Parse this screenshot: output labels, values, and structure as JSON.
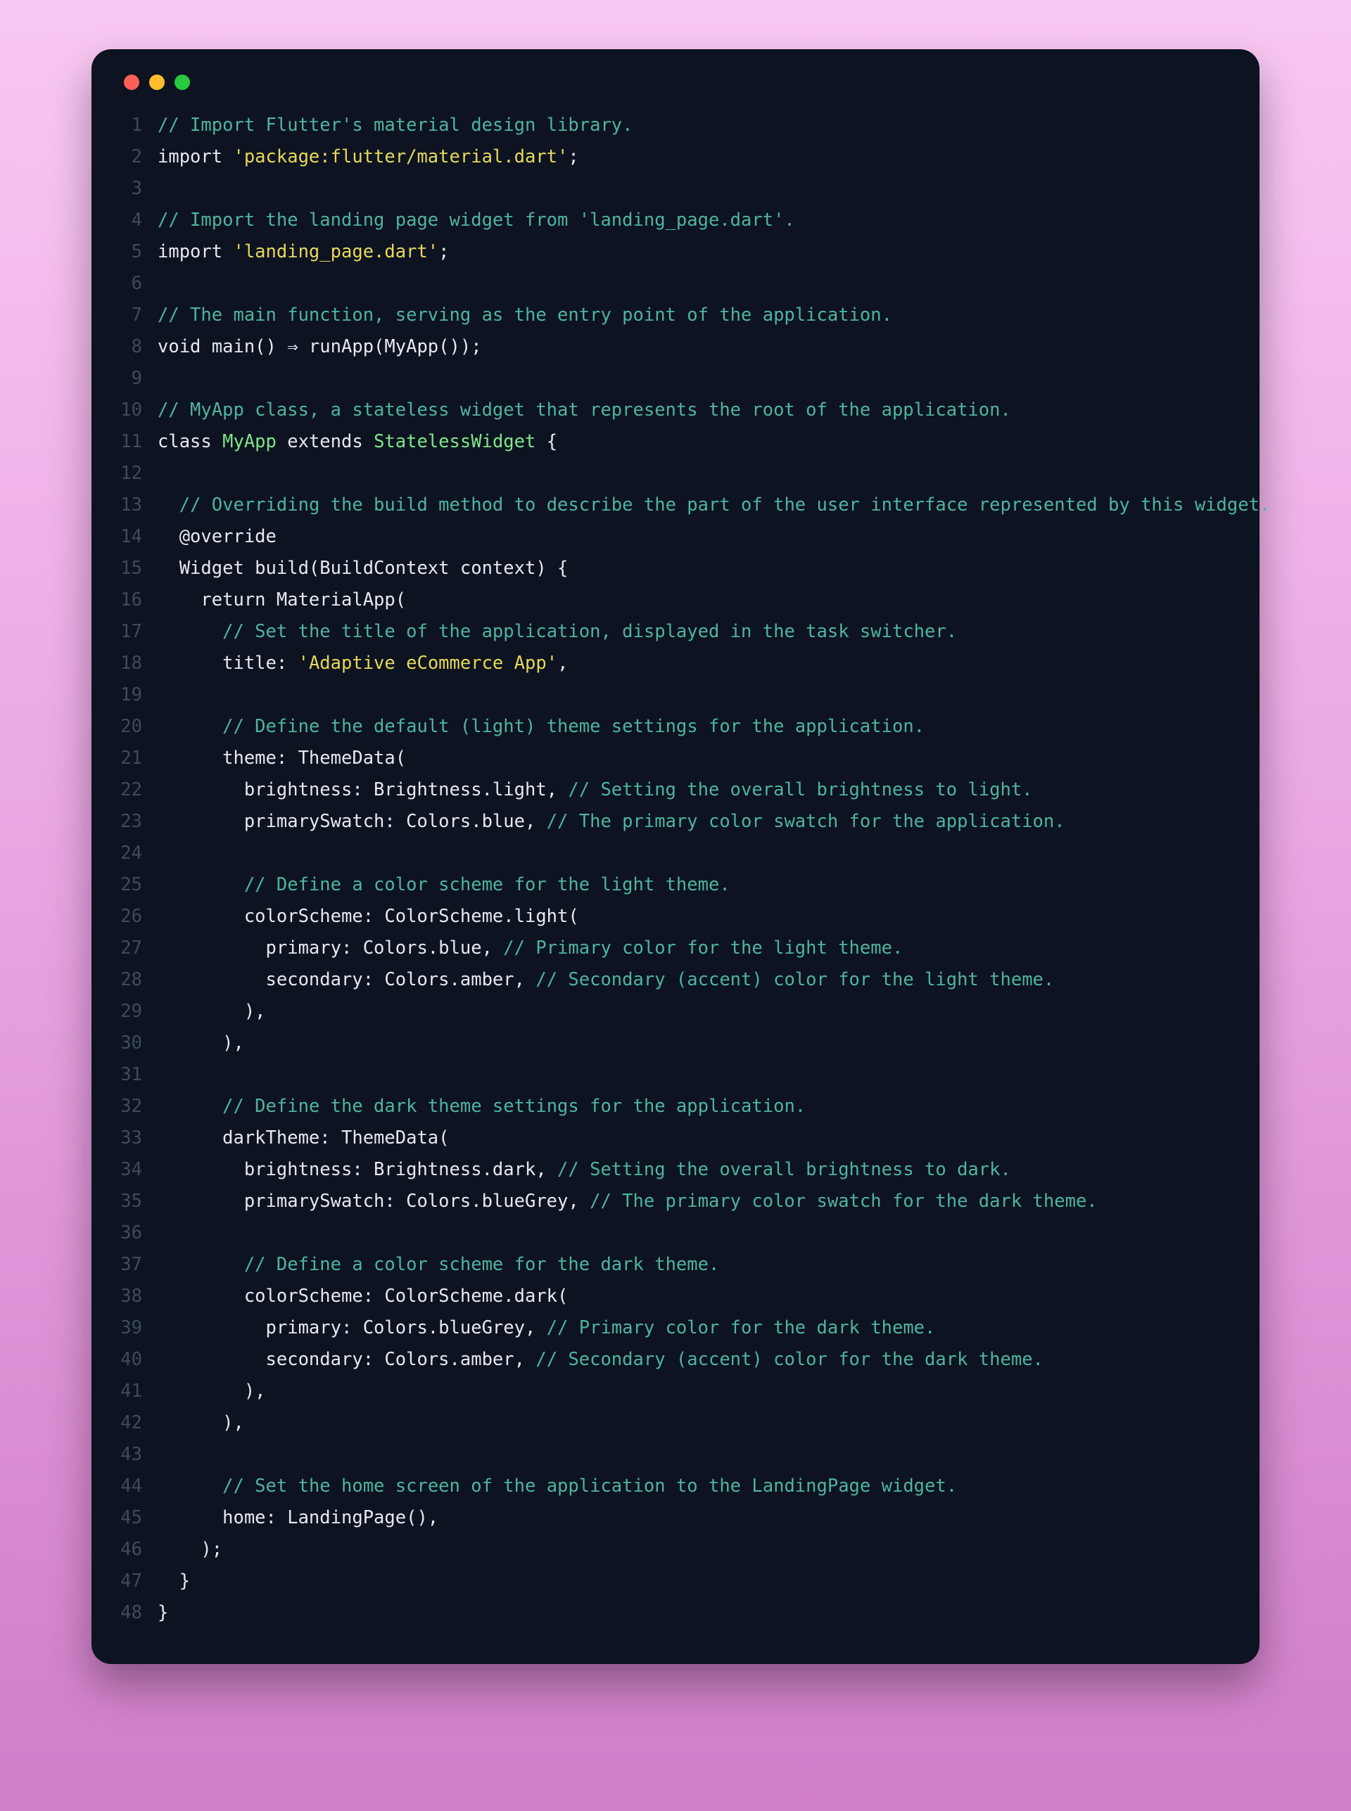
{
  "window": {
    "traffic_colors": {
      "red": "#ff5f56",
      "yellow": "#ffbd2e",
      "green": "#27c93f"
    }
  },
  "code_lines": [
    [
      {
        "t": "// Import Flutter's material design library.",
        "c": "comment"
      }
    ],
    [
      {
        "t": "import ",
        "c": "keyword"
      },
      {
        "t": "'package:flutter/material.dart'",
        "c": "string"
      },
      {
        "t": ";",
        "c": "plain"
      }
    ],
    [
      {
        "t": "",
        "c": "plain"
      }
    ],
    [
      {
        "t": "// Import the landing page widget from 'landing_page.dart'.",
        "c": "comment"
      }
    ],
    [
      {
        "t": "import ",
        "c": "keyword"
      },
      {
        "t": "'landing_page.dart'",
        "c": "string"
      },
      {
        "t": ";",
        "c": "plain"
      }
    ],
    [
      {
        "t": "",
        "c": "plain"
      }
    ],
    [
      {
        "t": "// The main function, serving as the entry point of the application.",
        "c": "comment"
      }
    ],
    [
      {
        "t": "void main() ⇒ runApp(MyApp());",
        "c": "plain"
      }
    ],
    [
      {
        "t": "",
        "c": "plain"
      }
    ],
    [
      {
        "t": "// MyApp class, a stateless widget that represents the root of the application.",
        "c": "comment"
      }
    ],
    [
      {
        "t": "class ",
        "c": "keyword"
      },
      {
        "t": "MyApp",
        "c": "class"
      },
      {
        "t": " extends ",
        "c": "keyword"
      },
      {
        "t": "StatelessWidget",
        "c": "type"
      },
      {
        "t": " {",
        "c": "plain"
      }
    ],
    [
      {
        "t": "",
        "c": "plain"
      }
    ],
    [
      {
        "t": "  ",
        "c": "plain"
      },
      {
        "t": "// Overriding the build method to describe the part of the user interface represented by this widget.",
        "c": "comment"
      }
    ],
    [
      {
        "t": "  @override",
        "c": "plain"
      }
    ],
    [
      {
        "t": "  Widget build(BuildContext context) {",
        "c": "plain"
      }
    ],
    [
      {
        "t": "    return MaterialApp(",
        "c": "plain"
      }
    ],
    [
      {
        "t": "      ",
        "c": "plain"
      },
      {
        "t": "// Set the title of the application, displayed in the task switcher.",
        "c": "comment"
      }
    ],
    [
      {
        "t": "      title: ",
        "c": "plain"
      },
      {
        "t": "'Adaptive eCommerce App'",
        "c": "string"
      },
      {
        "t": ",",
        "c": "plain"
      }
    ],
    [
      {
        "t": "",
        "c": "plain"
      }
    ],
    [
      {
        "t": "      ",
        "c": "plain"
      },
      {
        "t": "// Define the default (light) theme settings for the application.",
        "c": "comment"
      }
    ],
    [
      {
        "t": "      theme: ThemeData(",
        "c": "plain"
      }
    ],
    [
      {
        "t": "        brightness: Brightness.light, ",
        "c": "plain"
      },
      {
        "t": "// Setting the overall brightness to light.",
        "c": "comment"
      }
    ],
    [
      {
        "t": "        primarySwatch: Colors.blue, ",
        "c": "plain"
      },
      {
        "t": "// The primary color swatch for the application.",
        "c": "comment"
      }
    ],
    [
      {
        "t": "",
        "c": "plain"
      }
    ],
    [
      {
        "t": "        ",
        "c": "plain"
      },
      {
        "t": "// Define a color scheme for the light theme.",
        "c": "comment"
      }
    ],
    [
      {
        "t": "        colorScheme: ColorScheme.light(",
        "c": "plain"
      }
    ],
    [
      {
        "t": "          primary: Colors.blue, ",
        "c": "plain"
      },
      {
        "t": "// Primary color for the light theme.",
        "c": "comment"
      }
    ],
    [
      {
        "t": "          secondary: Colors.amber, ",
        "c": "plain"
      },
      {
        "t": "// Secondary (accent) color for the light theme.",
        "c": "comment"
      }
    ],
    [
      {
        "t": "        ),",
        "c": "plain"
      }
    ],
    [
      {
        "t": "      ),",
        "c": "plain"
      }
    ],
    [
      {
        "t": "",
        "c": "plain"
      }
    ],
    [
      {
        "t": "      ",
        "c": "plain"
      },
      {
        "t": "// Define the dark theme settings for the application.",
        "c": "comment"
      }
    ],
    [
      {
        "t": "      darkTheme: ThemeData(",
        "c": "plain"
      }
    ],
    [
      {
        "t": "        brightness: Brightness.dark, ",
        "c": "plain"
      },
      {
        "t": "// Setting the overall brightness to dark.",
        "c": "comment"
      }
    ],
    [
      {
        "t": "        primarySwatch: Colors.blueGrey, ",
        "c": "plain"
      },
      {
        "t": "// The primary color swatch for the dark theme.",
        "c": "comment"
      }
    ],
    [
      {
        "t": "",
        "c": "plain"
      }
    ],
    [
      {
        "t": "        ",
        "c": "plain"
      },
      {
        "t": "// Define a color scheme for the dark theme.",
        "c": "comment"
      }
    ],
    [
      {
        "t": "        colorScheme: ColorScheme.dark(",
        "c": "plain"
      }
    ],
    [
      {
        "t": "          primary: Colors.blueGrey, ",
        "c": "plain"
      },
      {
        "t": "// Primary color for the dark theme.",
        "c": "comment"
      }
    ],
    [
      {
        "t": "          secondary: Colors.amber, ",
        "c": "plain"
      },
      {
        "t": "// Secondary (accent) color for the dark theme.",
        "c": "comment"
      }
    ],
    [
      {
        "t": "        ),",
        "c": "plain"
      }
    ],
    [
      {
        "t": "      ),",
        "c": "plain"
      }
    ],
    [
      {
        "t": "",
        "c": "plain"
      }
    ],
    [
      {
        "t": "      ",
        "c": "plain"
      },
      {
        "t": "// Set the home screen of the application to the LandingPage widget.",
        "c": "comment"
      }
    ],
    [
      {
        "t": "      home: LandingPage(),",
        "c": "plain"
      }
    ],
    [
      {
        "t": "    );",
        "c": "plain"
      }
    ],
    [
      {
        "t": "  }",
        "c": "plain"
      }
    ],
    [
      {
        "t": "}",
        "c": "plain"
      }
    ]
  ]
}
